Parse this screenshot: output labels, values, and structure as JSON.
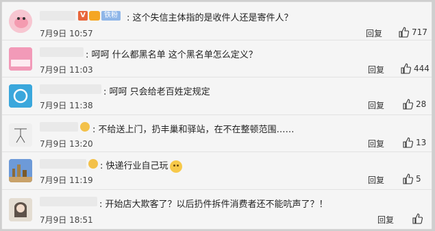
{
  "comments": [
    {
      "text": ": 这个失信主体指的是收件人还是寄件人？",
      "date": "7月9日",
      "time": "10:57",
      "reply": "回复",
      "likes": "717",
      "avatar": "peppa-pig-avatar",
      "badges": [
        "vip",
        "level",
        "fan"
      ],
      "fan_label": "铁粉"
    },
    {
      "text": ": 呵呵 什么都黑名单 这个黑名单怎么定义？",
      "date": "7月9日",
      "time": "11:03",
      "reply": "回复",
      "likes": "444",
      "avatar": "pink-card-avatar"
    },
    {
      "text": ": 呵呵 只会给老百姓定规定",
      "date": "7月9日",
      "time": "11:38",
      "reply": "回复",
      "likes": "28",
      "avatar": "cloud-avatar"
    },
    {
      "text": ": 不给送上门，扔丰巢和驿站，在不在整顿范围……",
      "date": "7月9日",
      "time": "13:20",
      "reply": "回复",
      "likes": "13",
      "avatar": "sketch-figure-avatar",
      "badges": [
        "emoji"
      ]
    },
    {
      "text": ": 快递行业自己玩",
      "date": "7月9日",
      "time": "11:19",
      "reply": "回复",
      "likes": "5",
      "avatar": "city-skyline-avatar",
      "badges": [
        "emoji"
      ]
    },
    {
      "text": ": 开始店大欺客了？以后扔件拆件消费者还不能吭声了？！",
      "date": "7月9日",
      "time": "18:51",
      "reply": "回复",
      "likes": "",
      "avatar": "girl-portrait-avatar"
    }
  ],
  "colors": {
    "background": "#f5f5f5",
    "border": "#e2e2e2",
    "text": "#222222"
  }
}
